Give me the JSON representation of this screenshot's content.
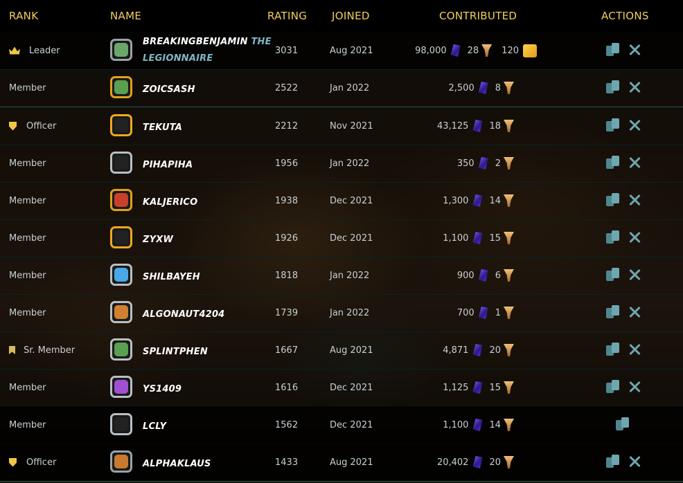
{
  "headers": {
    "rank": "RANK",
    "name": "NAME",
    "rating": "RATING",
    "joined": "JOINED",
    "contributed": "CONTRIBUTED",
    "actions": "ACTIONS"
  },
  "colors": {
    "header_text": "#f2cf5a",
    "row_divider": "#1f5a5e",
    "name_text": "#ffffff",
    "title_text": "#7fb7c4",
    "action_icon": "#6fa6b0"
  },
  "members": [
    {
      "rank": "Leader",
      "rank_icon": "crown-icon",
      "name": "BREAKINGBENJAMIN",
      "title": "THE",
      "title2": "LEGIONNAIRE",
      "rating": "3031",
      "joined": "Aug 2021",
      "gems": "98,000",
      "trophies": "28",
      "scrolls": "120",
      "avatar": "#6aa86a",
      "frame": "#9aa3a8",
      "actions": [
        "cards",
        "swords"
      ]
    },
    {
      "rank": "Member",
      "rank_icon": "",
      "name": "ZOICSASH",
      "title": "",
      "title2": "",
      "rating": "2522",
      "joined": "Jan 2022",
      "gems": "2,500",
      "trophies": "8",
      "scrolls": "",
      "avatar": "#5aa050",
      "frame": "#e0a21a",
      "actions": [
        "cards",
        "swords"
      ]
    },
    {
      "rank": "Officer",
      "rank_icon": "shield-icon",
      "name": "TEKUTA",
      "title": "",
      "title2": "",
      "rating": "2212",
      "joined": "Nov 2021",
      "gems": "43,125",
      "trophies": "18",
      "scrolls": "",
      "avatar": "#222222",
      "frame": "#f0a81e",
      "actions": [
        "cards",
        "swords"
      ]
    },
    {
      "rank": "Member",
      "rank_icon": "",
      "name": "PIHAPIHA",
      "title": "",
      "title2": "",
      "rating": "1956",
      "joined": "Jan 2022",
      "gems": "350",
      "trophies": "2",
      "scrolls": "",
      "avatar": "#222222",
      "frame": "#b8c0c4",
      "actions": [
        "cards",
        "swords"
      ]
    },
    {
      "rank": "Member",
      "rank_icon": "",
      "name": "KALJERICO",
      "title": "",
      "title2": "",
      "rating": "1938",
      "joined": "Dec 2021",
      "gems": "1,300",
      "trophies": "14",
      "scrolls": "",
      "avatar": "#c8402a",
      "frame": "#e0a21a",
      "actions": [
        "cards",
        "swords"
      ]
    },
    {
      "rank": "Member",
      "rank_icon": "",
      "name": "ZYXW",
      "title": "",
      "title2": "",
      "rating": "1926",
      "joined": "Dec 2021",
      "gems": "1,100",
      "trophies": "15",
      "scrolls": "",
      "avatar": "#222222",
      "frame": "#f0a81e",
      "actions": [
        "cards",
        "swords"
      ]
    },
    {
      "rank": "Member",
      "rank_icon": "",
      "name": "SHILBAYEH",
      "title": "",
      "title2": "",
      "rating": "1818",
      "joined": "Jan 2022",
      "gems": "900",
      "trophies": "6",
      "scrolls": "",
      "avatar": "#4aa8e8",
      "frame": "#b8c0c4",
      "actions": [
        "cards",
        "swords"
      ]
    },
    {
      "rank": "Member",
      "rank_icon": "",
      "name": "ALGONAUT4204",
      "title": "",
      "title2": "",
      "rating": "1739",
      "joined": "Jan 2022",
      "gems": "700",
      "trophies": "1",
      "scrolls": "",
      "avatar": "#d08030",
      "frame": "#b8c0c4",
      "actions": [
        "cards",
        "swords"
      ]
    },
    {
      "rank": "Sr. Member",
      "rank_icon": "bookmark-icon",
      "name": "SPLINTPHEN",
      "title": "",
      "title2": "",
      "rating": "1667",
      "joined": "Aug 2021",
      "gems": "4,871",
      "trophies": "20",
      "scrolls": "",
      "avatar": "#5aa050",
      "frame": "#b8c0c4",
      "actions": [
        "cards",
        "swords"
      ]
    },
    {
      "rank": "Member",
      "rank_icon": "",
      "name": "YS1409",
      "title": "",
      "title2": "",
      "rating": "1616",
      "joined": "Dec 2021",
      "gems": "1,125",
      "trophies": "15",
      "scrolls": "",
      "avatar": "#a050d0",
      "frame": "#b8c0c4",
      "actions": [
        "cards",
        "swords"
      ]
    },
    {
      "rank": "Member",
      "rank_icon": "",
      "name": "LCLY",
      "title": "",
      "title2": "",
      "rating": "1562",
      "joined": "Dec 2021",
      "gems": "1,100",
      "trophies": "14",
      "scrolls": "",
      "avatar": "#222222",
      "frame": "#b8c0c4",
      "actions": [
        "cards"
      ]
    },
    {
      "rank": "Officer",
      "rank_icon": "shield-icon",
      "name": "ALPHAKLAUS",
      "title": "",
      "title2": "",
      "rating": "1433",
      "joined": "Aug 2021",
      "gems": "20,402",
      "trophies": "20",
      "scrolls": "",
      "avatar": "#c87a30",
      "frame": "#9aa3a8",
      "actions": [
        "cards",
        "swords"
      ]
    }
  ]
}
